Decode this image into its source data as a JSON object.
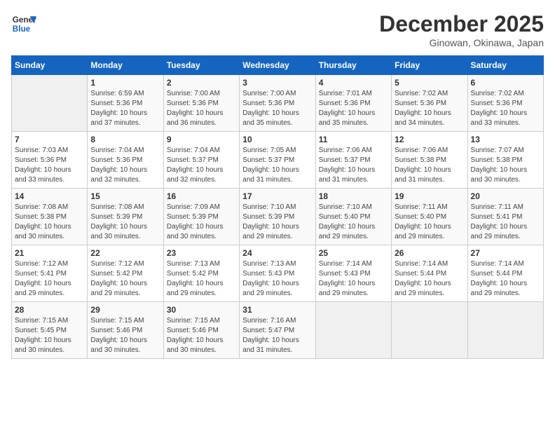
{
  "header": {
    "logo_line1": "General",
    "logo_line2": "Blue",
    "month_year": "December 2025",
    "location": "Ginowan, Okinawa, Japan"
  },
  "days_of_week": [
    "Sunday",
    "Monday",
    "Tuesday",
    "Wednesday",
    "Thursday",
    "Friday",
    "Saturday"
  ],
  "weeks": [
    [
      {
        "day": "",
        "info": ""
      },
      {
        "day": "1",
        "info": "Sunrise: 6:59 AM\nSunset: 5:36 PM\nDaylight: 10 hours\nand 37 minutes."
      },
      {
        "day": "2",
        "info": "Sunrise: 7:00 AM\nSunset: 5:36 PM\nDaylight: 10 hours\nand 36 minutes."
      },
      {
        "day": "3",
        "info": "Sunrise: 7:00 AM\nSunset: 5:36 PM\nDaylight: 10 hours\nand 35 minutes."
      },
      {
        "day": "4",
        "info": "Sunrise: 7:01 AM\nSunset: 5:36 PM\nDaylight: 10 hours\nand 35 minutes."
      },
      {
        "day": "5",
        "info": "Sunrise: 7:02 AM\nSunset: 5:36 PM\nDaylight: 10 hours\nand 34 minutes."
      },
      {
        "day": "6",
        "info": "Sunrise: 7:02 AM\nSunset: 5:36 PM\nDaylight: 10 hours\nand 33 minutes."
      }
    ],
    [
      {
        "day": "7",
        "info": "Sunrise: 7:03 AM\nSunset: 5:36 PM\nDaylight: 10 hours\nand 33 minutes."
      },
      {
        "day": "8",
        "info": "Sunrise: 7:04 AM\nSunset: 5:36 PM\nDaylight: 10 hours\nand 32 minutes."
      },
      {
        "day": "9",
        "info": "Sunrise: 7:04 AM\nSunset: 5:37 PM\nDaylight: 10 hours\nand 32 minutes."
      },
      {
        "day": "10",
        "info": "Sunrise: 7:05 AM\nSunset: 5:37 PM\nDaylight: 10 hours\nand 31 minutes."
      },
      {
        "day": "11",
        "info": "Sunrise: 7:06 AM\nSunset: 5:37 PM\nDaylight: 10 hours\nand 31 minutes."
      },
      {
        "day": "12",
        "info": "Sunrise: 7:06 AM\nSunset: 5:38 PM\nDaylight: 10 hours\nand 31 minutes."
      },
      {
        "day": "13",
        "info": "Sunrise: 7:07 AM\nSunset: 5:38 PM\nDaylight: 10 hours\nand 30 minutes."
      }
    ],
    [
      {
        "day": "14",
        "info": "Sunrise: 7:08 AM\nSunset: 5:38 PM\nDaylight: 10 hours\nand 30 minutes."
      },
      {
        "day": "15",
        "info": "Sunrise: 7:08 AM\nSunset: 5:39 PM\nDaylight: 10 hours\nand 30 minutes."
      },
      {
        "day": "16",
        "info": "Sunrise: 7:09 AM\nSunset: 5:39 PM\nDaylight: 10 hours\nand 30 minutes."
      },
      {
        "day": "17",
        "info": "Sunrise: 7:10 AM\nSunset: 5:39 PM\nDaylight: 10 hours\nand 29 minutes."
      },
      {
        "day": "18",
        "info": "Sunrise: 7:10 AM\nSunset: 5:40 PM\nDaylight: 10 hours\nand 29 minutes."
      },
      {
        "day": "19",
        "info": "Sunrise: 7:11 AM\nSunset: 5:40 PM\nDaylight: 10 hours\nand 29 minutes."
      },
      {
        "day": "20",
        "info": "Sunrise: 7:11 AM\nSunset: 5:41 PM\nDaylight: 10 hours\nand 29 minutes."
      }
    ],
    [
      {
        "day": "21",
        "info": "Sunrise: 7:12 AM\nSunset: 5:41 PM\nDaylight: 10 hours\nand 29 minutes."
      },
      {
        "day": "22",
        "info": "Sunrise: 7:12 AM\nSunset: 5:42 PM\nDaylight: 10 hours\nand 29 minutes."
      },
      {
        "day": "23",
        "info": "Sunrise: 7:13 AM\nSunset: 5:42 PM\nDaylight: 10 hours\nand 29 minutes."
      },
      {
        "day": "24",
        "info": "Sunrise: 7:13 AM\nSunset: 5:43 PM\nDaylight: 10 hours\nand 29 minutes."
      },
      {
        "day": "25",
        "info": "Sunrise: 7:14 AM\nSunset: 5:43 PM\nDaylight: 10 hours\nand 29 minutes."
      },
      {
        "day": "26",
        "info": "Sunrise: 7:14 AM\nSunset: 5:44 PM\nDaylight: 10 hours\nand 29 minutes."
      },
      {
        "day": "27",
        "info": "Sunrise: 7:14 AM\nSunset: 5:44 PM\nDaylight: 10 hours\nand 29 minutes."
      }
    ],
    [
      {
        "day": "28",
        "info": "Sunrise: 7:15 AM\nSunset: 5:45 PM\nDaylight: 10 hours\nand 30 minutes."
      },
      {
        "day": "29",
        "info": "Sunrise: 7:15 AM\nSunset: 5:46 PM\nDaylight: 10 hours\nand 30 minutes."
      },
      {
        "day": "30",
        "info": "Sunrise: 7:15 AM\nSunset: 5:46 PM\nDaylight: 10 hours\nand 30 minutes."
      },
      {
        "day": "31",
        "info": "Sunrise: 7:16 AM\nSunset: 5:47 PM\nDaylight: 10 hours\nand 31 minutes."
      },
      {
        "day": "",
        "info": ""
      },
      {
        "day": "",
        "info": ""
      },
      {
        "day": "",
        "info": ""
      }
    ]
  ]
}
